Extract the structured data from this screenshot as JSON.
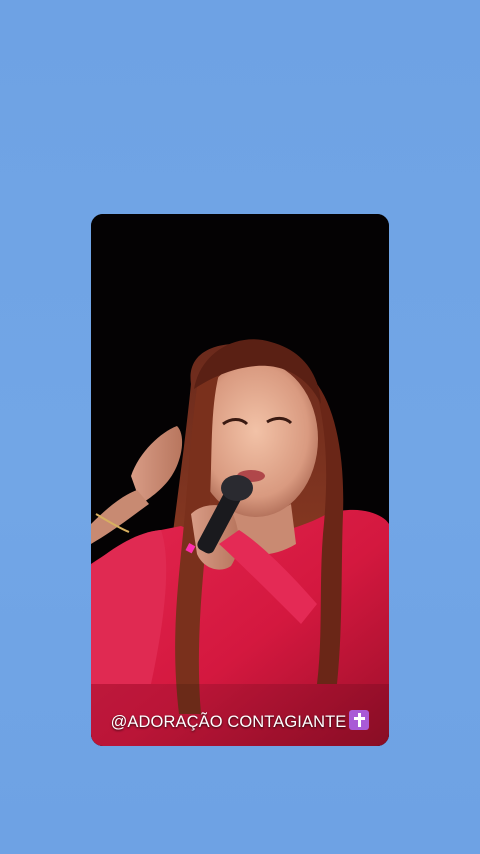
{
  "background_color": "#6fa3e3",
  "video": {
    "caption_text": "@ADORAÇÃO CONTAGIANTE",
    "caption_icon": "cross-icon"
  }
}
